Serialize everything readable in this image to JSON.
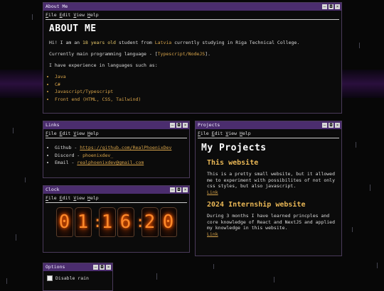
{
  "menu": [
    "File",
    "Edit",
    "View",
    "Help"
  ],
  "about": {
    "title": "About Me",
    "heading": "ABOUT ME",
    "p1_a": "Hi! I am an ",
    "p1_age": "18 years old",
    "p1_b": " student from ",
    "p1_country": "Latvia",
    "p1_c": " currently studying in Riga Technical College.",
    "p2_a": "Currently main programming language - [",
    "p2_lang": "Typescript/NodeJS",
    "p2_b": "].",
    "p3": "I have experience in languages such as:",
    "languages": [
      "Java",
      "C#",
      "Javascript/Typescript",
      "Front end (HTML, CSS, Tailwind)"
    ]
  },
  "links": {
    "title": "Links",
    "items": [
      {
        "label": "Github - ",
        "value": "https://github.com/RealPhoenixDev",
        "is_link": true
      },
      {
        "label": "Discord - ",
        "value": "phoenixdev_",
        "is_link": false
      },
      {
        "label": "Email - ",
        "value": "realphoenixdev@gmail.com",
        "is_link": true
      }
    ]
  },
  "clock": {
    "title": "Clock",
    "digits": [
      "0",
      "1",
      "1",
      "6",
      "2",
      "0"
    ]
  },
  "options": {
    "title": "Options",
    "disable_rain": "Disable rain"
  },
  "projects": {
    "title": "Projects",
    "heading": "My Projects",
    "items": [
      {
        "name": "This website",
        "desc": "This is a pretty small website, but it allowed me to experiment with possibilites of not only css styles, but also javascript.",
        "link": "Link"
      },
      {
        "name": "2024 Internship website",
        "desc": "During 3 months I have learned princples and core knowledge of React and NextJS and applied my knowledge in this website.",
        "link": "Link"
      }
    ]
  },
  "controls": {
    "minimize": "–",
    "maximize": "◘",
    "close": "×"
  },
  "colors": {
    "titlebar": "#4b2d6e",
    "accent": "#d8a44a",
    "background": "#070707"
  }
}
